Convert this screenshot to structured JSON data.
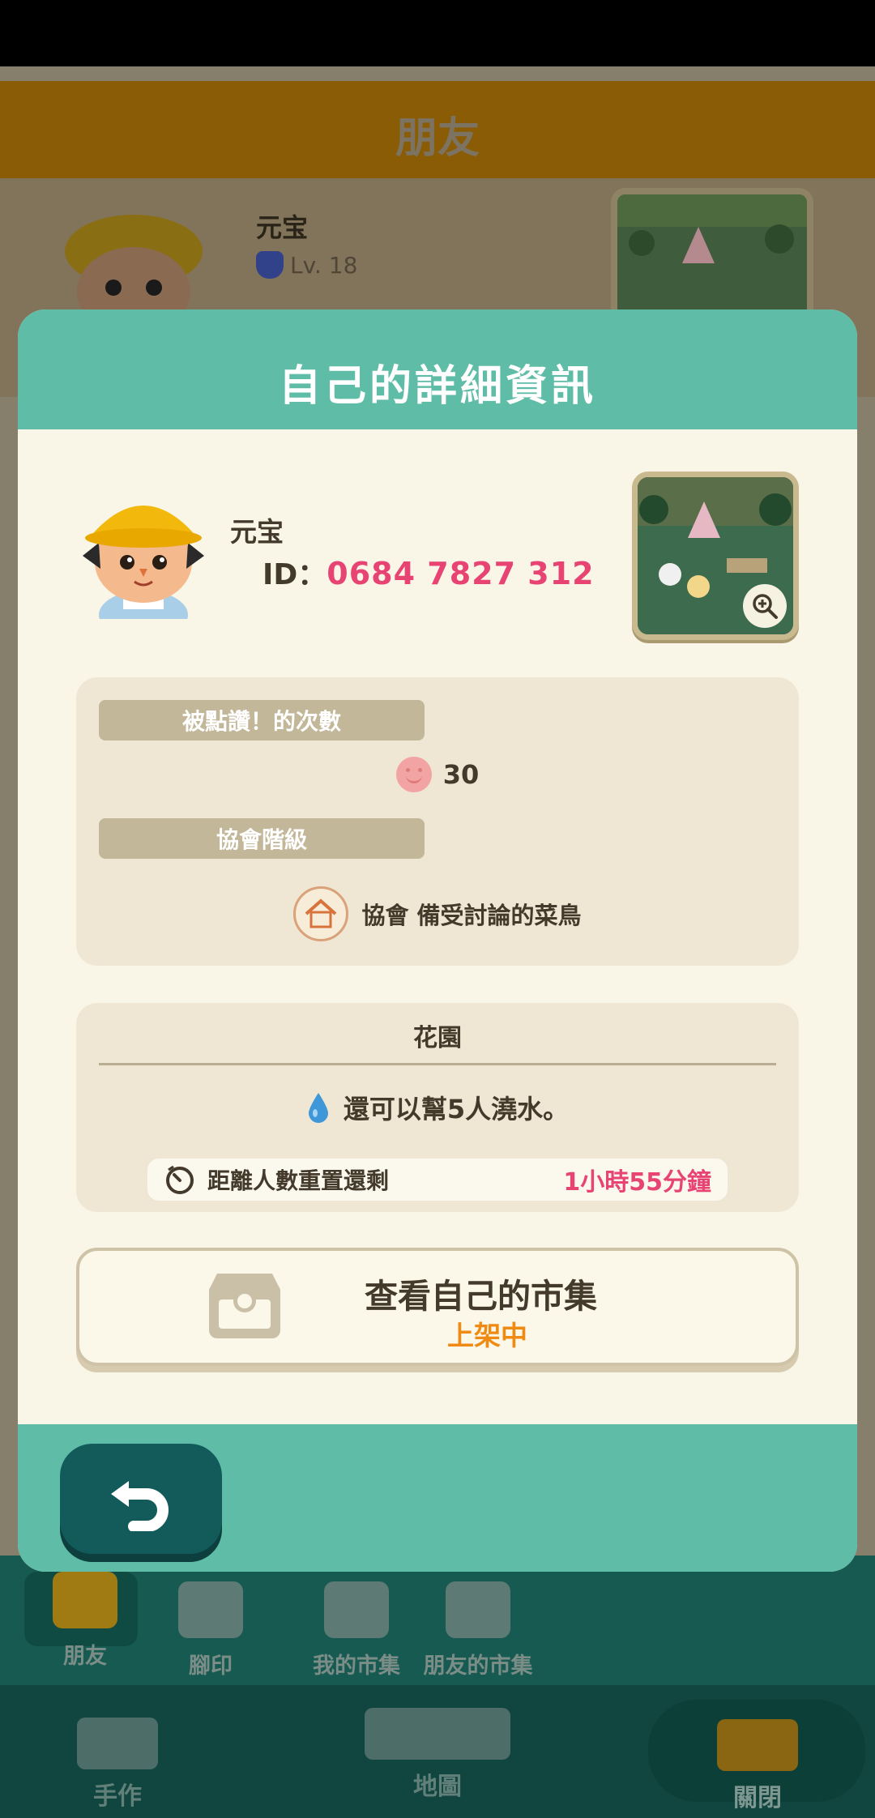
{
  "background": {
    "header_title": "朋友",
    "friend": {
      "name": "元宝",
      "level": "Lv. 18"
    }
  },
  "modal": {
    "title": "自己的詳細資訊",
    "player_name": "元宝",
    "id_label": "ID：",
    "id_value": "0684 7827 312",
    "likes": {
      "label": "被點讚！的次數",
      "count": "30",
      "icon": "smile-icon"
    },
    "rank": {
      "label": "協會階級",
      "value": "協會 備受討論的菜鳥",
      "icon": "association-house-icon"
    },
    "garden": {
      "title": "花園",
      "water_text": "還可以幫5人澆水。",
      "reset_label": "距離人數重置還剩",
      "reset_time": "1小時55分鐘"
    },
    "market_button": {
      "title": "查看自己的市集",
      "status": "上架中"
    }
  },
  "tabs": [
    {
      "label": "朋友",
      "icon": "friends-icon",
      "selected": true,
      "notification": true
    },
    {
      "label": "腳印",
      "icon": "footprint-icon"
    },
    {
      "label": "我的市集",
      "icon": "my-market-icon"
    },
    {
      "label": "朋友的市集",
      "icon": "friend-market-icon"
    }
  ],
  "bottom_bar": [
    {
      "label": "手作",
      "icon": "hammer-icon"
    },
    {
      "label": "地圖",
      "icon": "map-icon"
    },
    {
      "label": "關閉",
      "icon": "close-characters-icon"
    }
  ],
  "colors": {
    "accent_teal": "#5ebca7",
    "highlight_pink": "#e74473",
    "status_orange": "#ef8a12",
    "back_button": "#125b5a"
  }
}
